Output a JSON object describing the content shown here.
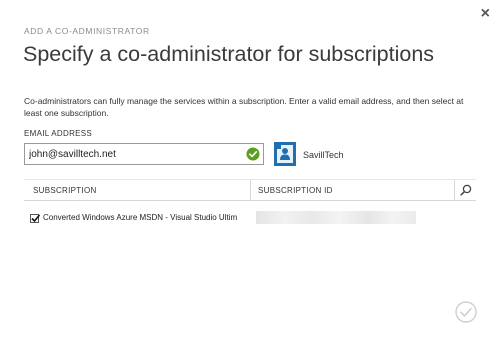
{
  "dialog": {
    "header_label": "ADD A CO-ADMINISTRATOR",
    "title": "Specify a co-administrator for subscriptions",
    "description": "Co-administrators can fully manage the services within a subscription. Enter a valid email address, and then select at least one subscription.",
    "close_glyph": "×"
  },
  "email": {
    "label": "EMAIL ADDRESS",
    "value": "john@savilltech.net",
    "valid_icon": "check-circle-icon",
    "valid_color": "#5aa01e"
  },
  "directory": {
    "icon": "directory-icon",
    "name": "SavillTech",
    "accent": "#1f6fb2"
  },
  "grid": {
    "columns": [
      "SUBSCRIPTION",
      "SUBSCRIPTION ID"
    ],
    "search_icon": "search-icon",
    "rows": [
      {
        "checked": true,
        "subscription": "Converted Windows Azure MSDN - Visual Studio Ultim"
      }
    ]
  },
  "footer": {
    "confirm_icon": "confirm-check-icon"
  }
}
